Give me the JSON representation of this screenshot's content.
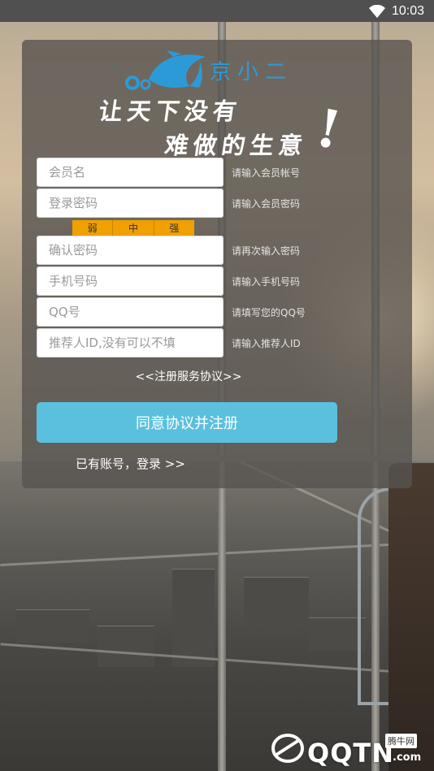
{
  "status_bar": {
    "time": "10:03"
  },
  "brand": {
    "logo_text": "京小二",
    "slogan_line1": "让天下没有",
    "slogan_line2": "难做的生意",
    "exclamation": "!"
  },
  "form": {
    "fields": [
      {
        "placeholder": "会员名",
        "hint": "请输入会员帐号"
      },
      {
        "placeholder": "登录密码",
        "hint": "请输入会员密码"
      },
      {
        "placeholder": "确认密码",
        "hint": "请再次输入密码"
      },
      {
        "placeholder": "手机号码",
        "hint": "请输入手机号码"
      },
      {
        "placeholder": "QQ号",
        "hint": "请填写您的QQ号"
      },
      {
        "placeholder": "推荐人ID,没有可以不填",
        "hint": "请输入推荐人ID"
      }
    ],
    "strength": [
      "弱",
      "中",
      "强"
    ],
    "agreement_link": "<<注册服务协议>>",
    "register_button": "同意协议并注册",
    "login_link": "已有账号，登录 >>"
  },
  "watermark": {
    "text": "QQTN",
    "suffix": ".com",
    "badge": "腾牛网"
  },
  "colors": {
    "button": "#5bc0de",
    "strength": "#f0a000",
    "logo": "#2d9ad8"
  }
}
